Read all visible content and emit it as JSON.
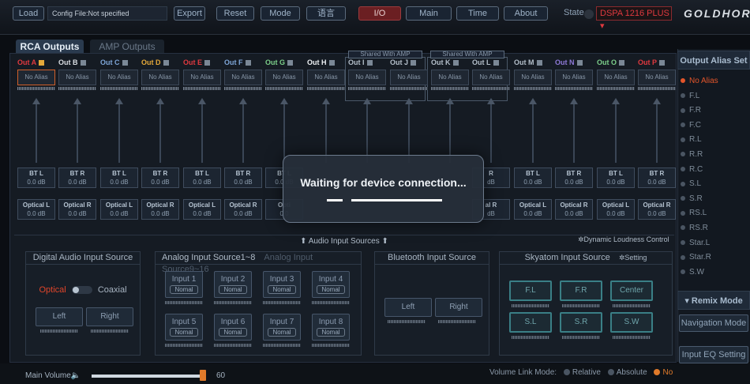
{
  "toolbar": {
    "load": "Load",
    "config_file": "Config File:Not specified",
    "export": "Export",
    "reset": "Reset",
    "mode": "Mode",
    "language": "语言",
    "io": "I/O",
    "main": "Main",
    "time": "Time",
    "about": "About",
    "state_label": "State",
    "model": "DSPA 1216 PLUS",
    "logo": "GOLDHORN"
  },
  "tabs": {
    "rca": "RCA Outputs",
    "amp": "AMP Outputs"
  },
  "shared_labels": [
    "Shared With AMP",
    "Shared With AMP"
  ],
  "outputs": [
    {
      "label": "Out A",
      "color": "#e0393f",
      "alias": "No Alias",
      "bt": "BT L",
      "bt_db": "0.0 dB",
      "opt": "Optical L",
      "opt_db": "0.0 dB"
    },
    {
      "label": "Out B",
      "color": "#d9dde2",
      "alias": "No Alias",
      "bt": "BT R",
      "bt_db": "0.0 dB",
      "opt": "Optical R",
      "opt_db": "0.0 dB"
    },
    {
      "label": "Out C",
      "color": "#7ea6d8",
      "alias": "No Alias",
      "bt": "BT L",
      "bt_db": "0.0 dB",
      "opt": "Optical L",
      "opt_db": "0.0 dB"
    },
    {
      "label": "Out D",
      "color": "#e5a93a",
      "alias": "No Alias",
      "bt": "BT R",
      "bt_db": "0.0 dB",
      "opt": "Optical R",
      "opt_db": "0.0 dB"
    },
    {
      "label": "Out E",
      "color": "#e0393f",
      "alias": "No Alias",
      "bt": "BT L",
      "bt_db": "0.0 dB",
      "opt": "Optical L",
      "opt_db": "0.0 dB"
    },
    {
      "label": "Out F",
      "color": "#7ea6d8",
      "alias": "No Alias",
      "bt": "BT R",
      "bt_db": "0.0 dB",
      "opt": "Optical R",
      "opt_db": "0.0 dB"
    },
    {
      "label": "Out G",
      "color": "#7ccf8a",
      "alias": "No Alias",
      "bt": "BT L",
      "bt_db": "0.0 dB",
      "opt": "Opti",
      "opt_db": "0.0"
    },
    {
      "label": "Out H",
      "color": "#eef2f5",
      "alias": "No Alias",
      "bt": "",
      "bt_db": "",
      "opt": "",
      "opt_db": ""
    },
    {
      "label": "Out I",
      "color": "#b4bfca",
      "alias": "No Alias",
      "bt": "",
      "bt_db": "",
      "opt": "",
      "opt_db": ""
    },
    {
      "label": "Out J",
      "color": "#b4bfca",
      "alias": "No Alias",
      "bt": "",
      "bt_db": "",
      "opt": "",
      "opt_db": ""
    },
    {
      "label": "Out K",
      "color": "#b4bfca",
      "alias": "No Alias",
      "bt": "",
      "bt_db": "",
      "opt": "",
      "opt_db": ""
    },
    {
      "label": "Out L",
      "color": "#b4bfca",
      "alias": "No Alias",
      "bt": "R",
      "bt_db": "dB",
      "opt": "al R",
      "opt_db": "dB"
    },
    {
      "label": "Out M",
      "color": "#b4bfca",
      "alias": "No Alias",
      "bt": "BT L",
      "bt_db": "0.0 dB",
      "opt": "Optical L",
      "opt_db": "0.0 dB"
    },
    {
      "label": "Out N",
      "color": "#8f7ad8",
      "alias": "No Alias",
      "bt": "BT R",
      "bt_db": "0.0 dB",
      "opt": "Optical R",
      "opt_db": "0.0 dB"
    },
    {
      "label": "Out O",
      "color": "#7ccf8a",
      "alias": "No Alias",
      "bt": "BT L",
      "bt_db": "0.0 dB",
      "opt": "Optical L",
      "opt_db": "0.0 dB"
    },
    {
      "label": "Out P",
      "color": "#e0393f",
      "alias": "No Alias",
      "bt": "BT R",
      "bt_db": "0.0 dB",
      "opt": "Optical R",
      "opt_db": "0.0 dB"
    }
  ],
  "overlay": {
    "message": "Waiting for device connection..."
  },
  "sources": {
    "title": "Audio Input Sources",
    "dynamic": "Dynamic Loudness Control",
    "digital": {
      "title": "Digital Audio Input Source",
      "optical": "Optical",
      "coaxial": "Coaxial",
      "left": "Left",
      "right": "Right"
    },
    "analog": {
      "title": "Analog Input Source1~8",
      "title2": "Analog Input Source9~16",
      "inputs": [
        "Input 1",
        "Input 2",
        "Input 3",
        "Input 4",
        "Input 5",
        "Input 6",
        "Input 7",
        "Input 8"
      ],
      "mode": "Nomal"
    },
    "bluetooth": {
      "title": "Bluetooth Input Source",
      "left": "Left",
      "right": "Right"
    },
    "skyatom": {
      "title": "Skyatom Input Source",
      "setting": "Setting",
      "channels": [
        "F.L",
        "F.R",
        "Center",
        "S.L",
        "S.R",
        "S.W"
      ]
    }
  },
  "alias_panel": {
    "title": "Output Alias Set",
    "items": [
      "No Alias",
      "F.L",
      "F.R",
      "F.C",
      "R.L",
      "R.R",
      "R.C",
      "S.L",
      "S.R",
      "RS.L",
      "RS.R",
      "Star.L",
      "Star.R",
      "S.W"
    ],
    "remix": "Remix Mode",
    "navigation": "Navigation Mode",
    "input_eq": "Input EQ Setting"
  },
  "bottom": {
    "main_volume": "Main Volume",
    "volume_value": "60",
    "volume_level": 0.98,
    "link_mode": "Volume Link Mode:",
    "relative": "Relative",
    "absolute": "Absolute",
    "no": "No"
  }
}
